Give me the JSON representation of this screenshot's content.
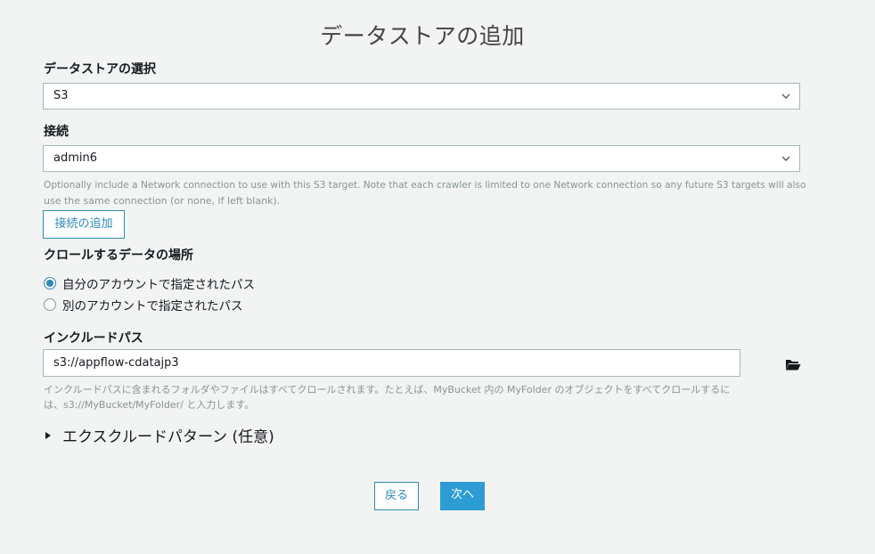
{
  "page": {
    "title": "データストアの追加"
  },
  "datastore": {
    "label": "データストアの選択",
    "selected": "S3"
  },
  "connection": {
    "label": "接続",
    "selected": "admin6",
    "help_line1": "Optionally include a Network connection to use with this S3 target. Note that each crawler is limited to one Network connection so any future S3 targets will also",
    "help_line2": "use the same connection (or none, if left blank).",
    "add_button": "接続の追加"
  },
  "location": {
    "label": "クロールするデータの場所",
    "options": [
      {
        "label": "自分のアカウントで指定されたパス",
        "checked": true
      },
      {
        "label": "別のアカウントで指定されたパス",
        "checked": false
      }
    ]
  },
  "include_path": {
    "label": "インクルードパス",
    "value": "s3://appflow-cdatajp3",
    "help_line1": "インクルードパスに含まれるフォルダやファイルはすべてクロールされます。たとえば、MyBucket 内の MyFolder のオブジェクトをすべてクロールするに",
    "help_line2": "は、s3://MyBucket/MyFolder/ と入力します。",
    "browse_icon": "folder-open-icon"
  },
  "exclude": {
    "label": "エクスクルードパターン (任意)"
  },
  "footer": {
    "back": "戻る",
    "next": "次へ"
  },
  "colors": {
    "accent": "#2d8bb8",
    "primary": "#2d9cd3",
    "background": "#f2f3f3"
  }
}
